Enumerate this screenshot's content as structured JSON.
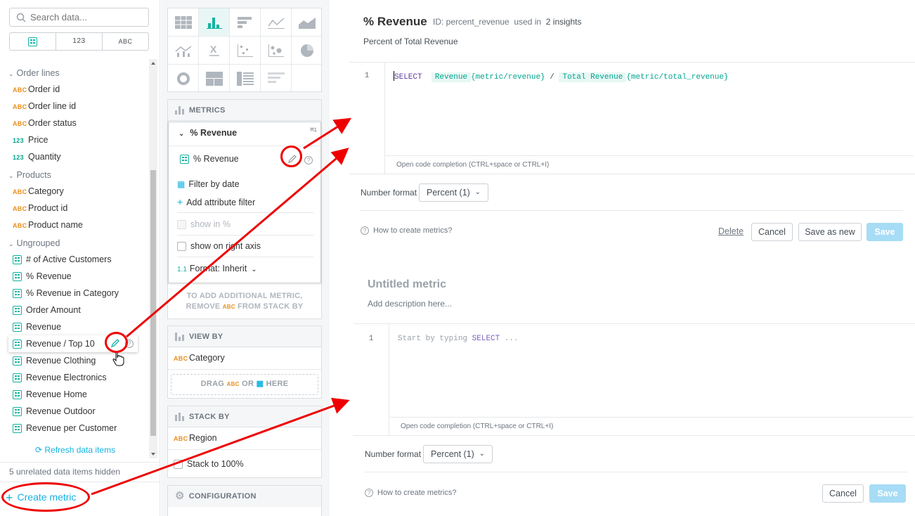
{
  "left": {
    "search_placeholder": "Search data...",
    "filter_tabs": [
      "",
      "123",
      "ABC"
    ],
    "groups": [
      {
        "name": "Order lines",
        "items": [
          {
            "type": "ABC",
            "label": "Order id"
          },
          {
            "type": "ABC",
            "label": "Order line id"
          },
          {
            "type": "ABC",
            "label": "Order status"
          },
          {
            "type": "123",
            "label": "Price"
          },
          {
            "type": "123",
            "label": "Quantity"
          }
        ]
      },
      {
        "name": "Products",
        "items": [
          {
            "type": "ABC",
            "label": "Category"
          },
          {
            "type": "ABC",
            "label": "Product id"
          },
          {
            "type": "ABC",
            "label": "Product name"
          }
        ]
      },
      {
        "name": "Ungrouped",
        "items": [
          {
            "type": "metric",
            "label": "# of Active Customers"
          },
          {
            "type": "metric",
            "label": "% Revenue"
          },
          {
            "type": "metric",
            "label": "% Revenue in Category"
          },
          {
            "type": "metric",
            "label": "Order Amount"
          },
          {
            "type": "metric",
            "label": "Revenue"
          },
          {
            "type": "metric",
            "label": "Revenue / Top 10"
          },
          {
            "type": "metric",
            "label": "Revenue Clothing"
          },
          {
            "type": "metric",
            "label": "Revenue Electronics"
          },
          {
            "type": "metric",
            "label": "Revenue Home"
          },
          {
            "type": "metric",
            "label": "Revenue Outdoor"
          },
          {
            "type": "metric",
            "label": "Revenue per Customer"
          }
        ]
      }
    ],
    "refresh_label": "Refresh data items",
    "hidden_note": "5 unrelated data items hidden",
    "create_metric": "Create metric"
  },
  "middle": {
    "metrics_header": "METRICS",
    "metric_name": "% Revenue",
    "metric_tag": "M1",
    "metric_item": "% Revenue",
    "filter_by_date": "Filter by date",
    "add_attribute_filter": "Add attribute filter",
    "show_in_percent": "show in %",
    "show_on_right_axis": "show on right axis",
    "format_prefix": "1.1",
    "format_label": "Format: Inherit",
    "stack_hint_1": "TO ADD ADDITIONAL METRIC,",
    "stack_hint_2a": "REMOVE",
    "stack_hint_abc": "ABC",
    "stack_hint_2b": "FROM STACK BY",
    "view_by_header": "VIEW BY",
    "view_by_type": "ABC",
    "view_by_value": "Category",
    "drag_label_a": "DRAG",
    "drag_label_abc": "ABC",
    "drag_label_or": "OR",
    "drag_label_here": "HERE",
    "stack_by_header": "STACK BY",
    "stack_by_type": "ABC",
    "stack_by_value": "Region",
    "stack_to_100": "Stack to 100%",
    "configuration_header": "CONFIGURATION"
  },
  "editor1": {
    "title": "% Revenue",
    "id_label": "ID: percent_revenue",
    "used_in": "used in",
    "used_count": "2 insights",
    "description": "Percent of Total Revenue",
    "line_no": "1",
    "code_select": "SELECT",
    "code_chip1": "Revenue",
    "code_ref1": "{metric/revenue}",
    "code_op": "/",
    "code_chip2": "Total Revenue",
    "code_ref2": "{metric/total_revenue}",
    "completion_hint": "Open code completion (CTRL+space or CTRL+I)",
    "number_format_label": "Number format",
    "number_format_value": "Percent (1)",
    "help_link": "How to create metrics?",
    "delete": "Delete",
    "cancel": "Cancel",
    "save_as_new": "Save as new",
    "save": "Save"
  },
  "editor2": {
    "title": "Untitled metric",
    "description_placeholder": "Add description here...",
    "line_no": "1",
    "code_placeholder_a": "Start by typing",
    "code_placeholder_kw": "SELECT",
    "code_placeholder_b": "...",
    "completion_hint": "Open code completion (CTRL+space or CTRL+I)",
    "number_format_label": "Number format",
    "number_format_value": "Percent (1)",
    "help_link": "How to create metrics?",
    "cancel": "Cancel",
    "save": "Save"
  },
  "colors": {
    "accent": "#14b2a1",
    "annotation": "#e00000",
    "link": "#14b2e2"
  }
}
